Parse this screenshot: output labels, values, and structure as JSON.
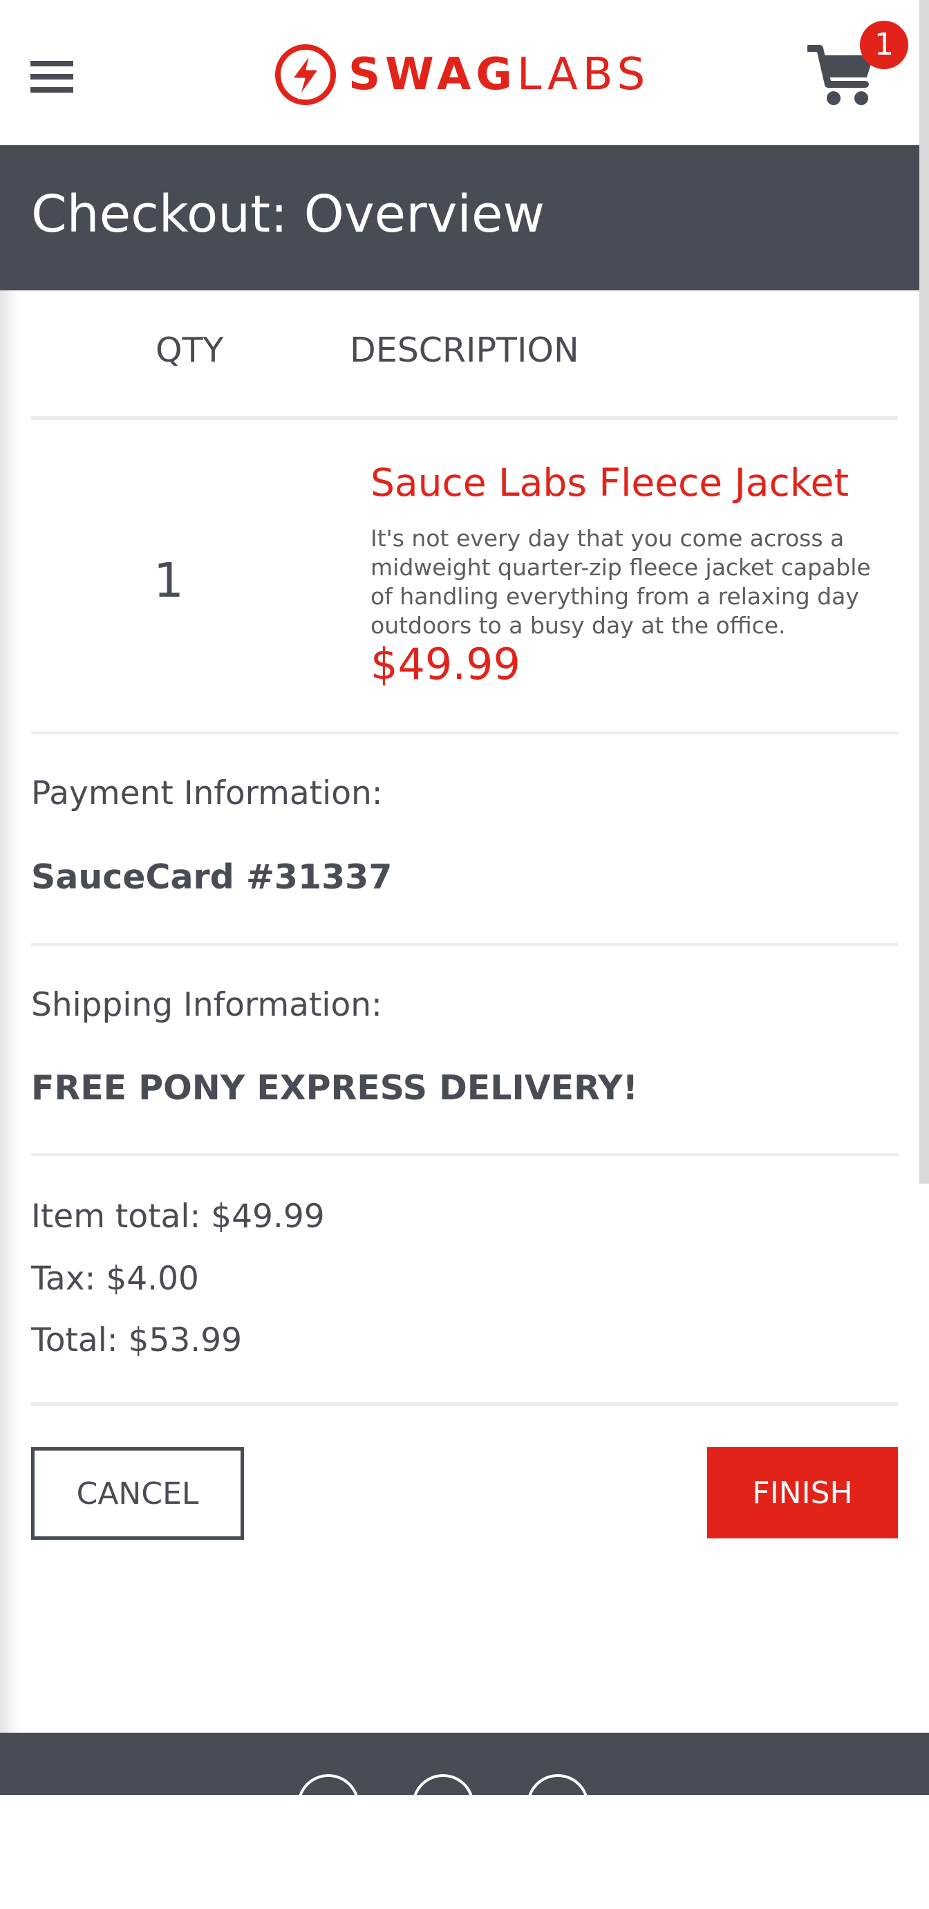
{
  "header": {
    "logo_text_bold": "SWAG",
    "logo_text_light": "LABS",
    "cart_count": "1",
    "menu_icon": "hamburger-menu-icon",
    "cart_icon": "shopping-cart-icon"
  },
  "page": {
    "title": "Checkout: Overview"
  },
  "columns": {
    "qty": "QTY",
    "description": "DESCRIPTION"
  },
  "item": {
    "qty": "1",
    "name": "Sauce Labs Fleece Jacket",
    "description": "It's not every day that you come across a midweight quarter-zip fleece jacket capable of handling everything from a relaxing day outdoors to a busy day at the office.",
    "price": "$49.99"
  },
  "payment": {
    "label": "Payment Information:",
    "value": "SauceCard #31337"
  },
  "shipping": {
    "label": "Shipping Information:",
    "value": "FREE PONY EXPRESS DELIVERY!"
  },
  "summary": {
    "item_total": "Item total: $49.99",
    "tax": "Tax: $4.00",
    "total": "Total: $53.99"
  },
  "buttons": {
    "cancel": "CANCEL",
    "finish": "FINISH"
  },
  "footer": {
    "social_icons": [
      "twitter-icon",
      "facebook-icon",
      "linkedin-icon"
    ]
  },
  "colors": {
    "brand_red": "#e2231a",
    "dark_bar": "#474c55"
  }
}
